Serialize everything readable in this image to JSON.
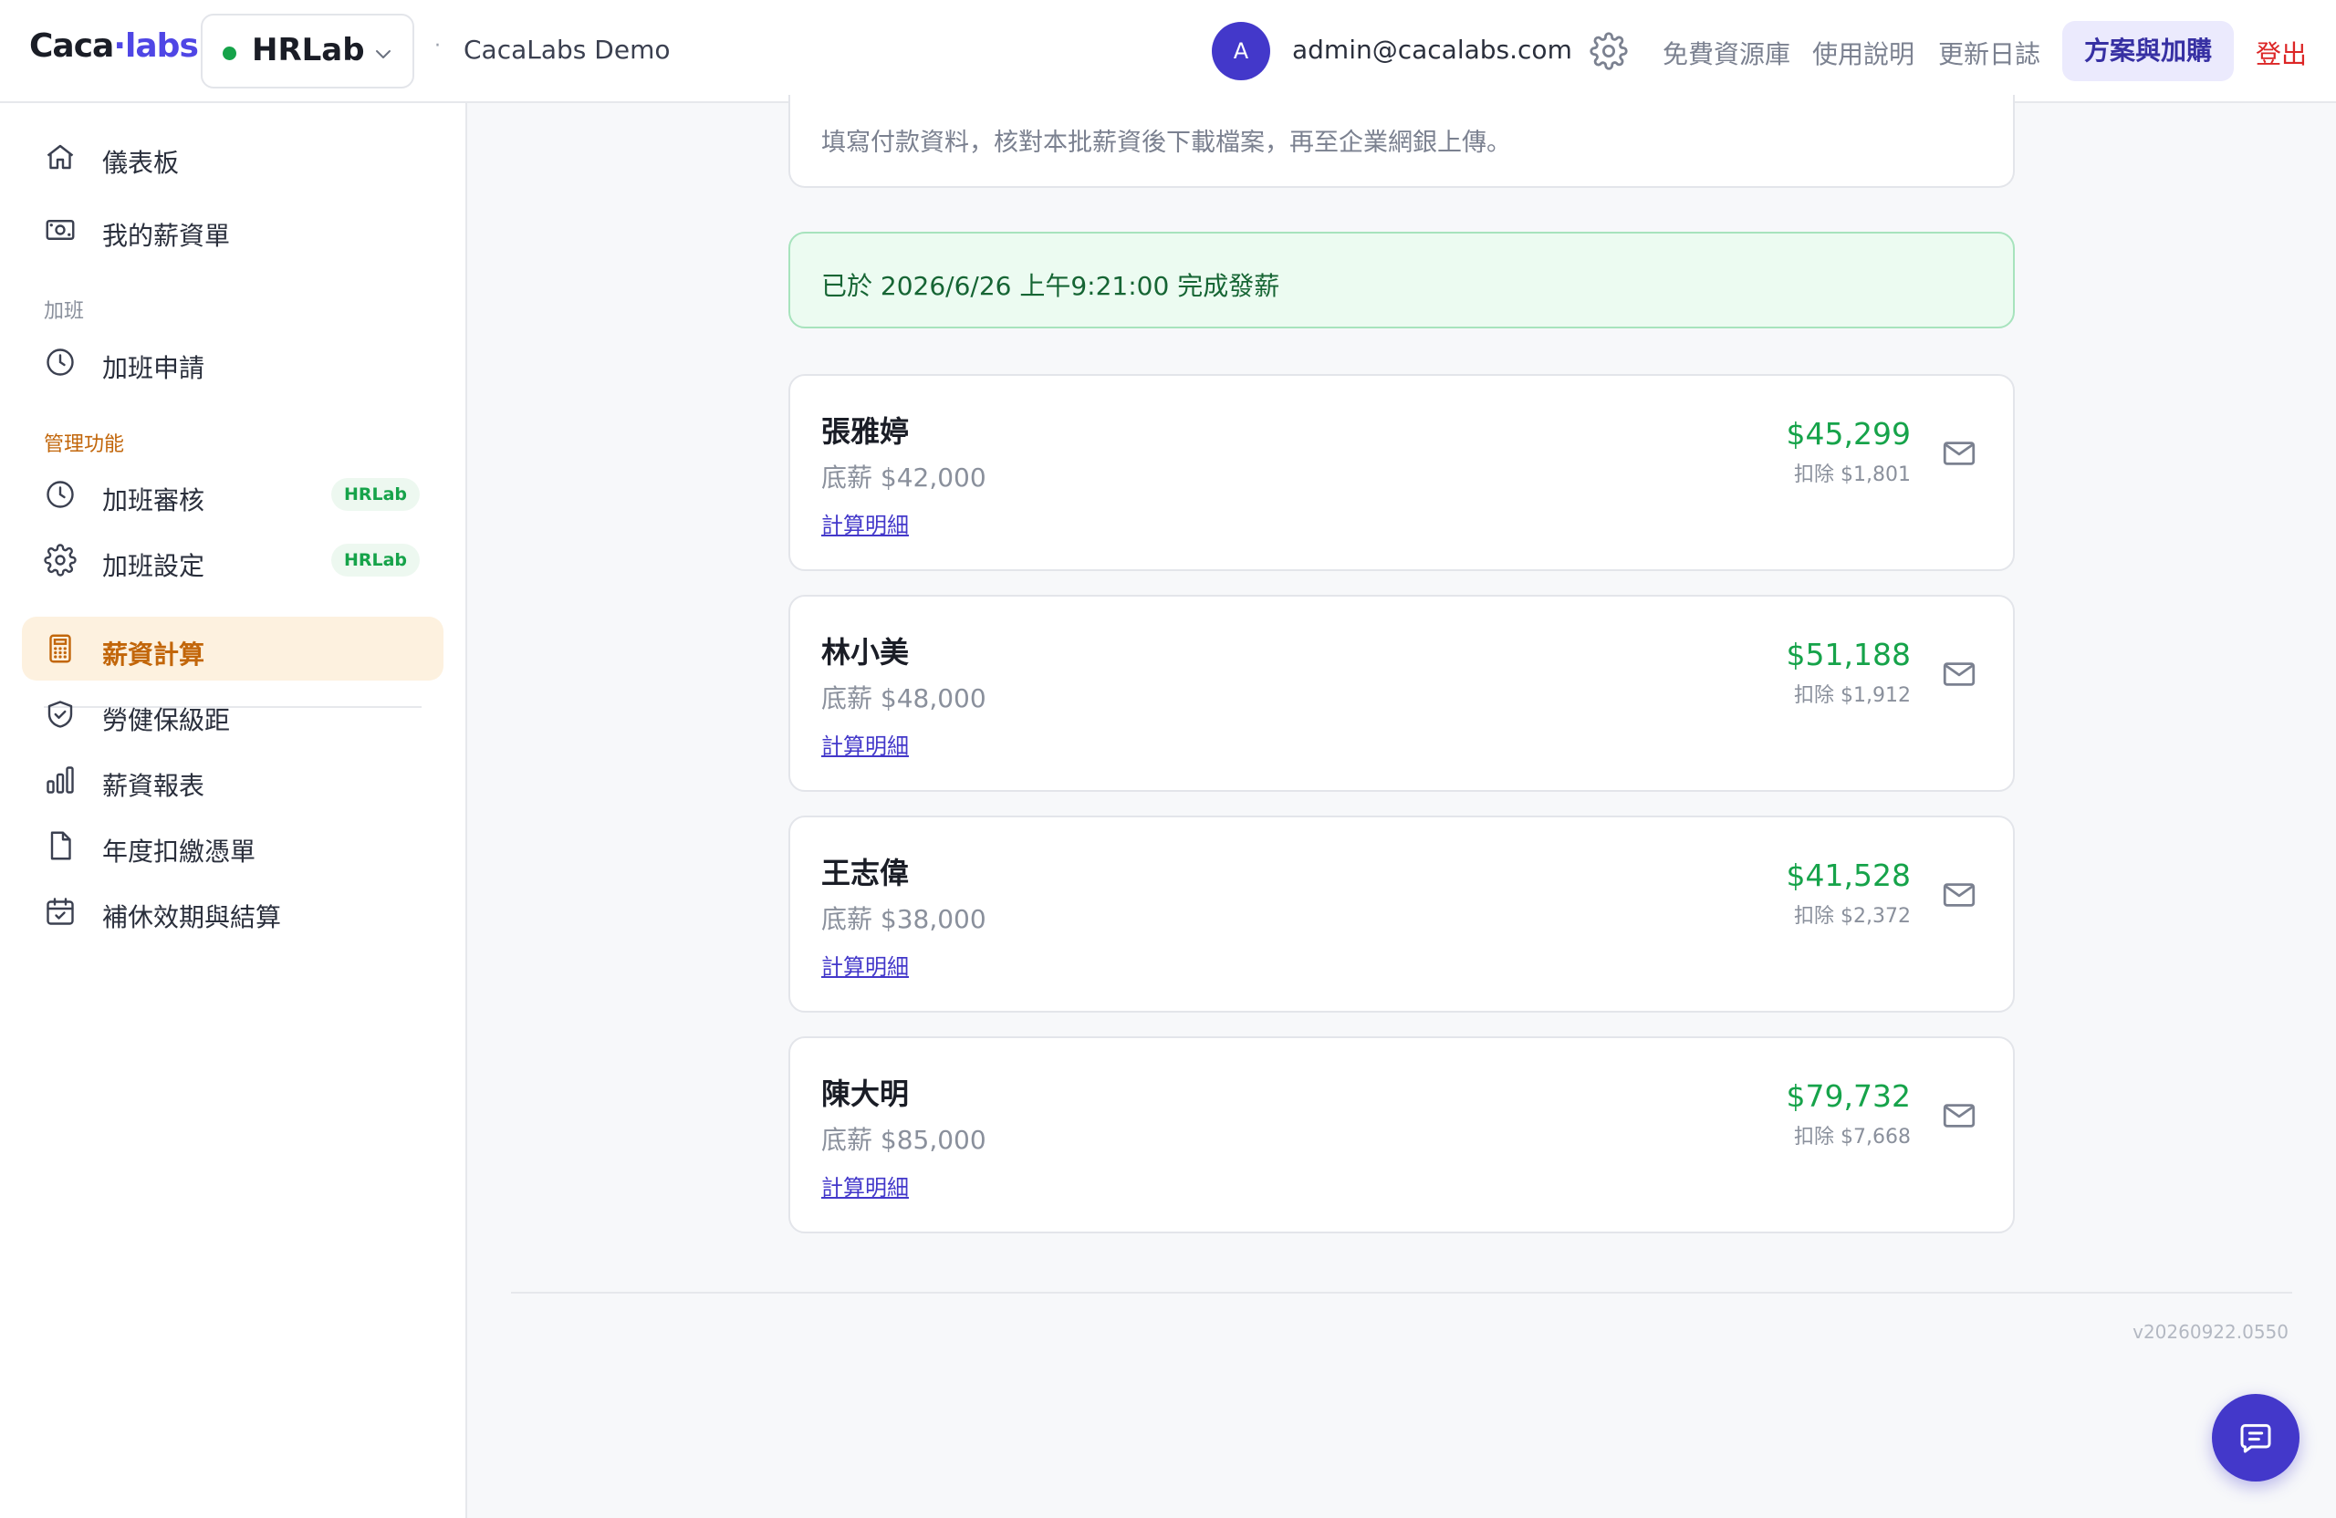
{
  "header": {
    "brand_part1": "Caca",
    "brand_dot": "·",
    "brand_part2": "labs",
    "app_name": "HRLab",
    "org_separator": "·",
    "org_name": "CacaLabs Demo",
    "avatar_initial": "A",
    "email": "admin@cacalabs.com",
    "links": [
      "免費資源庫",
      "使用說明",
      "更新日誌"
    ],
    "plan_button": "方案與加購",
    "logout": "登出",
    "accent_color": "#4338ca",
    "logout_color": "#dc2626"
  },
  "sidebar": {
    "items": [
      {
        "label": "儀表板",
        "icon": "home-icon"
      },
      {
        "label": "我的薪資單",
        "icon": "payslip-icon"
      }
    ],
    "section_overtime": "加班",
    "overtime_items": [
      {
        "label": "加班申請",
        "icon": "clock-icon"
      }
    ],
    "section_management": "管理功能",
    "management_items": [
      {
        "label": "加班審核",
        "icon": "clock-icon",
        "badge": "HRLab"
      },
      {
        "label": "加班設定",
        "icon": "gear-icon",
        "badge": "HRLab"
      }
    ],
    "payroll_items": [
      {
        "label": "薪資計算",
        "icon": "calculator-icon",
        "active": true
      },
      {
        "label": "勞健保級距",
        "icon": "shield-icon"
      },
      {
        "label": "薪資報表",
        "icon": "bar-chart-icon"
      },
      {
        "label": "年度扣繳憑單",
        "icon": "document-icon"
      },
      {
        "label": "補休效期與結算",
        "icon": "calendar-icon"
      }
    ]
  },
  "main": {
    "instruction": "填寫付款資料，核對本批薪資後下載檔案，再至企業網銀上傳。",
    "success_message": "已於 2026/6/26 上午9:21:00 完成發薪",
    "employees": [
      {
        "name": "張雅婷",
        "base": "底薪 $42,000",
        "detail_link": "計算明細",
        "net": "$45,299",
        "deduction": "扣除 $1,801"
      },
      {
        "name": "林小美",
        "base": "底薪 $48,000",
        "detail_link": "計算明細",
        "net": "$51,188",
        "deduction": "扣除 $1,912"
      },
      {
        "name": "王志偉",
        "base": "底薪 $38,000",
        "detail_link": "計算明細",
        "net": "$41,528",
        "deduction": "扣除 $2,372"
      },
      {
        "name": "陳大明",
        "base": "底薪 $85,000",
        "detail_link": "計算明細",
        "net": "$79,732",
        "deduction": "扣除 $7,668"
      }
    ],
    "net_color": "#16a34a"
  },
  "footer": {
    "version": "v20260922.0550"
  }
}
